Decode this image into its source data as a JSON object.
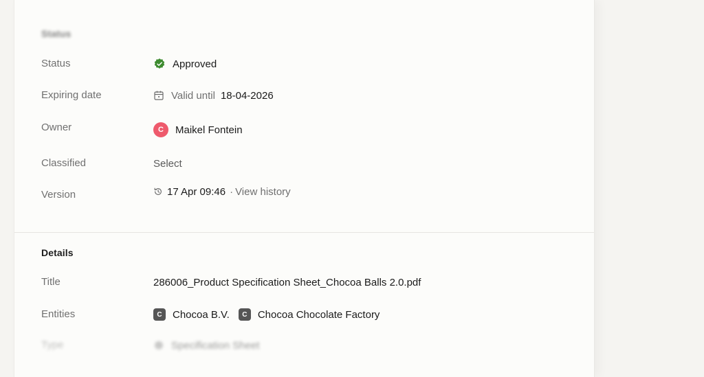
{
  "status_section": {
    "title": "Status",
    "rows": {
      "status": {
        "label": "Status",
        "value": "Approved",
        "badge_color": "#3d8b2f"
      },
      "expiring": {
        "label": "Expiring date",
        "prefix": "Valid until",
        "date": "18-04-2026"
      },
      "owner": {
        "label": "Owner",
        "avatar_initial": "C",
        "name": "Maikel Fontein",
        "avatar_color": "#ee5a6c"
      },
      "classified": {
        "label": "Classified",
        "value": "Select"
      },
      "version": {
        "label": "Version",
        "timestamp": "17 Apr 09:46",
        "separator": "·",
        "link": "View history"
      }
    }
  },
  "details_section": {
    "title": "Details",
    "rows": {
      "title": {
        "label": "Title",
        "value": "286006_Product Specification Sheet_Chocoa Balls 2.0.pdf"
      },
      "entities": {
        "label": "Entities",
        "items": [
          {
            "icon_letter": "C",
            "name": "Chocoa B.V."
          },
          {
            "icon_letter": "C",
            "name": "Chocoa Chocolate Factory"
          }
        ]
      },
      "type": {
        "label": "Type",
        "value": "Specification Sheet"
      }
    }
  },
  "icons": {
    "status": "verified-badge-icon",
    "calendar": "calendar-icon",
    "history": "history-icon",
    "entity": "company-icon",
    "type": "document-type-icon"
  }
}
